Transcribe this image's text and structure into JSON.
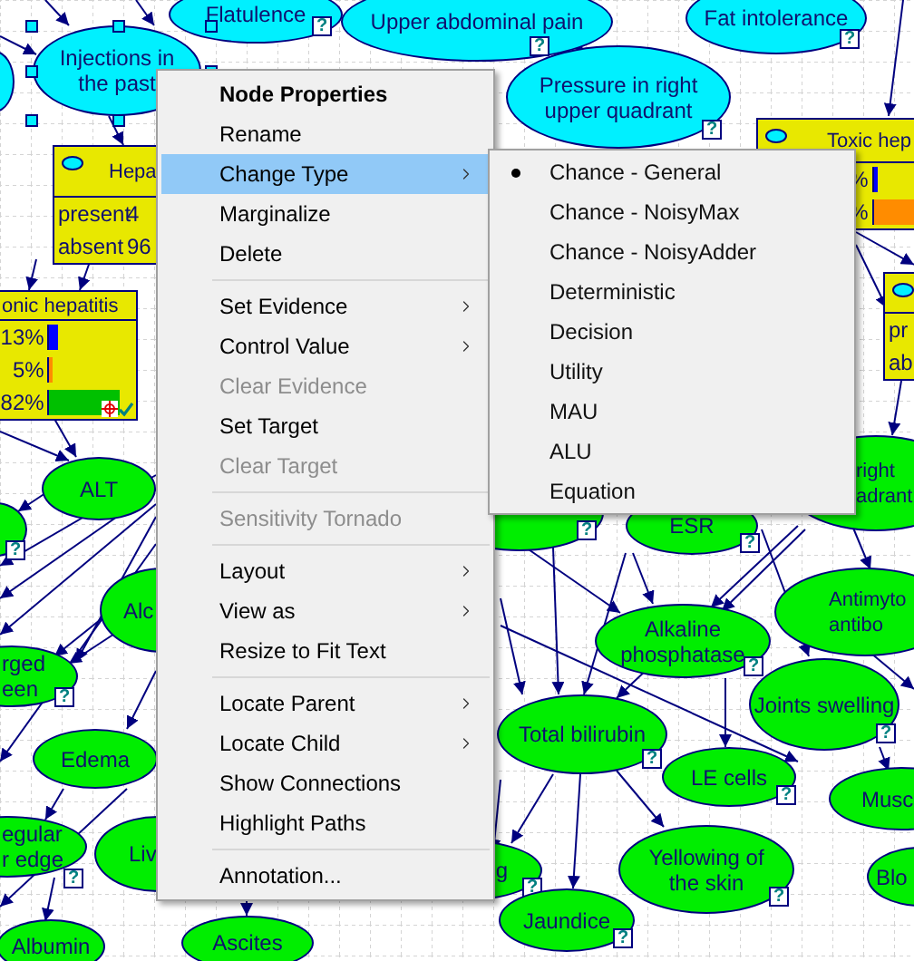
{
  "canvas": {
    "nodes": [
      {
        "label": "Flatulence",
        "color": "#00f0ff",
        "badge": "?",
        "selected": false
      },
      {
        "label": "Upper abdominal pain",
        "color": "#00f0ff",
        "badge": "?",
        "selected": false
      },
      {
        "label": "Fat intolerance",
        "color": "#00f0ff",
        "badge": "?",
        "selected": false
      },
      {
        "color": "#00f0ff",
        "selected": false
      },
      {
        "label": "Injections in\nthe past",
        "color": "#00f0ff",
        "selected": true
      },
      {
        "label": "Pressure in right\nupper quadrant",
        "color": "#00f0ff",
        "badge": "?",
        "selected": false
      },
      {
        "label": "ALT",
        "color": "#00ee00",
        "selected": false
      },
      {
        "color": "#00ee00",
        "badge": "?",
        "selected": false
      },
      {
        "label": "right\nadrant",
        "color": "#00ee00",
        "selected": false
      },
      {
        "color": "#00ee00",
        "badge": "?",
        "selected": false
      },
      {
        "label": "ESR",
        "color": "#00ee00",
        "badge": "?",
        "selected": false
      },
      {
        "label": "Alc",
        "color": "#00ee00",
        "selected": false
      },
      {
        "label": "rged\neen",
        "color": "#00ee00",
        "badge": "?",
        "selected": false
      },
      {
        "label": "Alkaline\nphosphatase",
        "color": "#00ee00",
        "badge": "?",
        "selected": false
      },
      {
        "label": "Antimyto\nantibo",
        "color": "#00ee00",
        "selected": false
      },
      {
        "label": "Joints swelling",
        "color": "#00ee00",
        "badge": "?",
        "selected": false
      },
      {
        "label": "Edema",
        "color": "#00ee00",
        "selected": false
      },
      {
        "label": "Total bilirubin",
        "color": "#00ee00",
        "badge": "?",
        "selected": false
      },
      {
        "label": "LE cells",
        "color": "#00ee00",
        "badge": "?",
        "selected": false
      },
      {
        "label": "Musc",
        "color": "#00ee00",
        "selected": false
      },
      {
        "label": "egular\nr edge",
        "color": "#00ee00",
        "badge": "?",
        "selected": false
      },
      {
        "label": "Liv",
        "color": "#00ee00",
        "selected": false
      },
      {
        "label": "g",
        "color": "#00ee00",
        "badge": "?",
        "selected": false
      },
      {
        "label": "Yellowing of\nthe skin",
        "color": "#00ee00",
        "badge": "?",
        "selected": false
      },
      {
        "label": "Blo",
        "color": "#00ee00",
        "selected": false
      },
      {
        "label": "Albumin",
        "color": "#00ee00",
        "selected": false
      },
      {
        "label": "Ascites",
        "color": "#00ee00",
        "selected": false
      },
      {
        "label": "Jaundice",
        "color": "#00ee00",
        "badge": "?",
        "selected": false
      }
    ],
    "bar_nodes": [
      {
        "title": "Hepa",
        "rows": [
          {
            "label": "present",
            "value": "4"
          },
          {
            "label": "absent",
            "value": "96"
          }
        ]
      },
      {
        "title": "onic hepatitis",
        "target": true,
        "observed": true,
        "rows": [
          {
            "value": "13%",
            "level": 0.1,
            "color": "#0000ff"
          },
          {
            "value": "5%",
            "level": 0.04,
            "color": "#ff8c00"
          },
          {
            "value": "82%",
            "level": 0.78,
            "color": "#00c000"
          }
        ]
      },
      {
        "title": "Toxic hep",
        "rows": [
          {
            "value": "%",
            "level": 0.04,
            "color": "#0000ff"
          },
          {
            "value": "%",
            "level": 0.9,
            "color": "#ff8c00"
          }
        ]
      },
      {
        "rows": [
          {
            "label": "pr"
          },
          {
            "label": "ab"
          }
        ]
      }
    ]
  },
  "context_menu": {
    "items": [
      {
        "label": "Node Properties",
        "kind": "header",
        "disabled": false,
        "selected": false
      },
      {
        "label": "Rename",
        "kind": "item",
        "disabled": false,
        "selected": false
      },
      {
        "label": "Change Type",
        "kind": "submenu",
        "disabled": false,
        "selected": true
      },
      {
        "label": "Marginalize",
        "kind": "item",
        "disabled": false,
        "selected": false
      },
      {
        "label": "Delete",
        "kind": "item",
        "disabled": false,
        "selected": false
      },
      {
        "kind": "separator"
      },
      {
        "label": "Set Evidence",
        "kind": "submenu",
        "disabled": false,
        "selected": false
      },
      {
        "label": "Control Value",
        "kind": "submenu",
        "disabled": false,
        "selected": false
      },
      {
        "label": "Clear Evidence",
        "kind": "item",
        "disabled": true,
        "selected": false
      },
      {
        "label": "Set Target",
        "kind": "item",
        "disabled": false,
        "selected": false
      },
      {
        "label": "Clear Target",
        "kind": "item",
        "disabled": true,
        "selected": false
      },
      {
        "kind": "separator"
      },
      {
        "label": "Sensitivity Tornado",
        "kind": "item",
        "disabled": true,
        "selected": false
      },
      {
        "kind": "separator"
      },
      {
        "label": "Layout",
        "kind": "submenu",
        "disabled": false,
        "selected": false
      },
      {
        "label": "View as",
        "kind": "submenu",
        "disabled": false,
        "selected": false
      },
      {
        "label": "Resize to Fit Text",
        "kind": "item",
        "disabled": false,
        "selected": false
      },
      {
        "kind": "separator"
      },
      {
        "label": "Locate Parent",
        "kind": "submenu",
        "disabled": false,
        "selected": false
      },
      {
        "label": "Locate Child",
        "kind": "submenu",
        "disabled": false,
        "selected": false
      },
      {
        "label": "Show Connections",
        "kind": "item",
        "disabled": false,
        "selected": false
      },
      {
        "label": "Highlight Paths",
        "kind": "item",
        "disabled": false,
        "selected": false
      },
      {
        "kind": "separator"
      },
      {
        "label": "Annotation...",
        "kind": "item",
        "disabled": false,
        "selected": false
      }
    ]
  },
  "submenu": {
    "items": [
      {
        "label": "Chance - General",
        "selected": true
      },
      {
        "label": "Chance - NoisyMax",
        "selected": false
      },
      {
        "label": "Chance - NoisyAdder",
        "selected": false
      },
      {
        "label": "Deterministic",
        "selected": false
      },
      {
        "label": "Decision",
        "selected": false
      },
      {
        "label": "Utility",
        "selected": false
      },
      {
        "label": "MAU",
        "selected": false
      },
      {
        "label": "ALU",
        "selected": false
      },
      {
        "label": "Equation",
        "selected": false
      }
    ]
  }
}
